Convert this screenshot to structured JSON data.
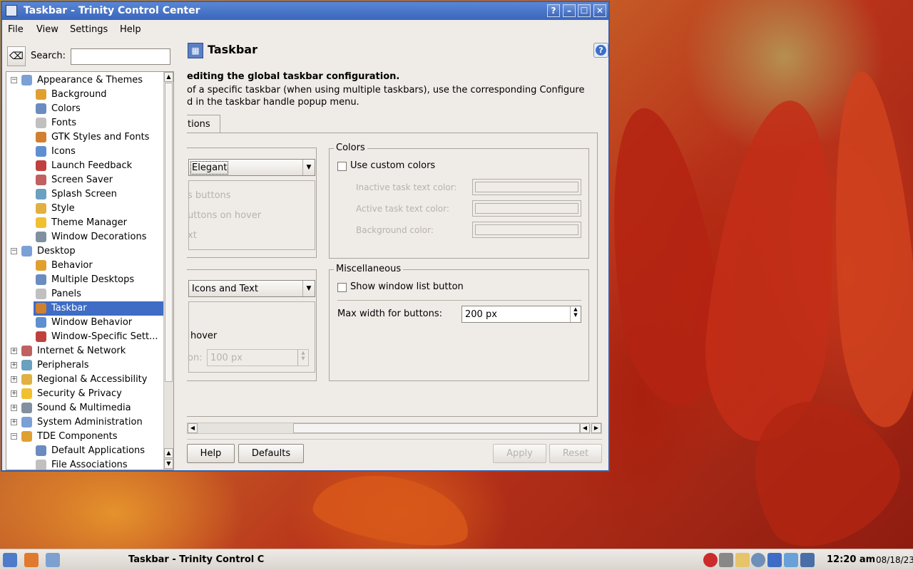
{
  "window": {
    "title": "Taskbar - Trinity Control Center",
    "buttons": [
      "?",
      "–",
      "☐",
      "✕"
    ]
  },
  "menu": [
    "File",
    "View",
    "Settings",
    "Help"
  ],
  "search": {
    "label": "Search:",
    "value": ""
  },
  "tree": [
    {
      "label": "Appearance & Themes",
      "level": 0,
      "expanded": true
    },
    {
      "label": "Background",
      "level": 1
    },
    {
      "label": "Colors",
      "level": 1
    },
    {
      "label": "Fonts",
      "level": 1
    },
    {
      "label": "GTK Styles and Fonts",
      "level": 1
    },
    {
      "label": "Icons",
      "level": 1
    },
    {
      "label": "Launch Feedback",
      "level": 1
    },
    {
      "label": "Screen Saver",
      "level": 1
    },
    {
      "label": "Splash Screen",
      "level": 1
    },
    {
      "label": "Style",
      "level": 1
    },
    {
      "label": "Theme Manager",
      "level": 1
    },
    {
      "label": "Window Decorations",
      "level": 1
    },
    {
      "label": "Desktop",
      "level": 0,
      "expanded": true
    },
    {
      "label": "Behavior",
      "level": 1
    },
    {
      "label": "Multiple Desktops",
      "level": 1
    },
    {
      "label": "Panels",
      "level": 1
    },
    {
      "label": "Taskbar",
      "level": 1,
      "selected": true
    },
    {
      "label": "Window Behavior",
      "level": 1
    },
    {
      "label": "Window-Specific Sett...",
      "level": 1
    },
    {
      "label": "Internet & Network",
      "level": 0,
      "expanded": false
    },
    {
      "label": "Peripherals",
      "level": 0,
      "expanded": false
    },
    {
      "label": "Regional & Accessibility",
      "level": 0,
      "expanded": false
    },
    {
      "label": "Security & Privacy",
      "level": 0,
      "expanded": false
    },
    {
      "label": "Sound & Multimedia",
      "level": 0,
      "expanded": false
    },
    {
      "label": "System Administration",
      "level": 0,
      "expanded": false
    },
    {
      "label": "TDE Components",
      "level": 0,
      "expanded": true
    },
    {
      "label": "Default Applications",
      "level": 1
    },
    {
      "label": "File Associations",
      "level": 1
    }
  ],
  "page": {
    "title": "Taskbar",
    "desc_line1": "editing the global taskbar configuration.",
    "desc_line2": "of a specific taskbar (when using multiple taskbars), use the corresponding Configure",
    "desc_line3": "d in the taskbar handle popup menu.",
    "tab_label": "tions"
  },
  "appearance": {
    "style_value": "Elegant",
    "opt1": "s buttons",
    "opt2": "uttons on hover",
    "opt3": "xt"
  },
  "colors": {
    "title": "Colors",
    "use_custom": "Use custom colors",
    "inactive": "Inactive task text color:",
    "active": "Active task text color:",
    "background": "Background color:"
  },
  "buttons_group": {
    "display_value": "Icons and Text",
    "hover": "hover",
    "spin_label": "on:",
    "spin_value": "100 px"
  },
  "misc": {
    "title": "Miscellaneous",
    "show_window_list": "Show window list button",
    "max_width_label": "Max width for buttons:",
    "max_width_value": "200 px"
  },
  "footer": {
    "help": "Help",
    "defaults": "Defaults",
    "apply": "Apply",
    "reset": "Reset"
  },
  "taskbar": {
    "task": "Taskbar - Trinity Control C",
    "time": "12:20 am",
    "date": "08/18/23"
  },
  "colors_accent": {
    "titlebar": "#3a66bb",
    "selection": "#3f6cc4"
  }
}
